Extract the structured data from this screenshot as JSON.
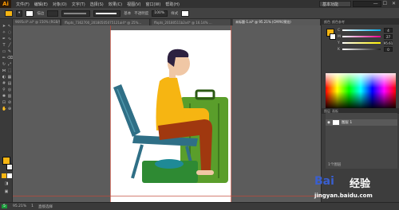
{
  "app": {
    "logo": "Ai",
    "title": "Adobe Illustrator"
  },
  "menubar": {
    "items": [
      "文件(F)",
      "编辑(E)",
      "对象(O)",
      "文字(T)",
      "选择(S)",
      "效果(C)",
      "视图(V)",
      "窗口(W)",
      "帮助(H)"
    ],
    "workspace": "基本功能",
    "window_controls": [
      "—",
      "☐",
      "✕"
    ]
  },
  "controlbar": {
    "fill_color": "#f6b512",
    "stroke_label": "描边",
    "stroke_style_label": "基本",
    "opacity_label": "不透明度",
    "opacity_value": "100%",
    "style_label": "样式"
  },
  "tabs": [
    {
      "label": "9695c4*.ai* @ 150% (RGB/预览)",
      "active": false
    },
    {
      "label": "ffopts_7362700_20180505075121ai4* @ 25%...",
      "active": false
    },
    {
      "label": "ffopts_20180511b2x4* @ 16.14% ...",
      "active": false
    },
    {
      "label": "未标题-1.ai* @ 95.21% (CMYK/预览)",
      "active": true
    }
  ],
  "color_panel": {
    "tabs": [
      "颜色",
      "颜色参考"
    ],
    "sliders": [
      {
        "label": "C",
        "value": "4",
        "color": "#00aeef"
      },
      {
        "label": "M",
        "value": "27",
        "color": "#ec008c"
      },
      {
        "label": "Y",
        "value": "95.61",
        "color": "#fff200"
      },
      {
        "label": "K",
        "value": "0",
        "color": "#222222"
      }
    ],
    "swatch_color": "#f6b512"
  },
  "layers_panel": {
    "tabs": [
      "图层",
      "画板"
    ],
    "layer_name": "图层 1",
    "footer": "1个图层"
  },
  "statusbar": {
    "zoom": "95.21%",
    "page": "1",
    "tool": "直接选择",
    "left_badge": "5"
  },
  "watermark": {
    "brand": "Bai",
    "jingyan": "经验",
    "url": "jingyan.baidu.com"
  },
  "artwork": {
    "shirt": "#f6b512",
    "pants": "#a0380f",
    "suitcase": "#5a9e2b",
    "chair": "#2f6f86",
    "bag": "#1f8a97",
    "hair": "#2d2140",
    "skin": "#f0c7a5"
  }
}
